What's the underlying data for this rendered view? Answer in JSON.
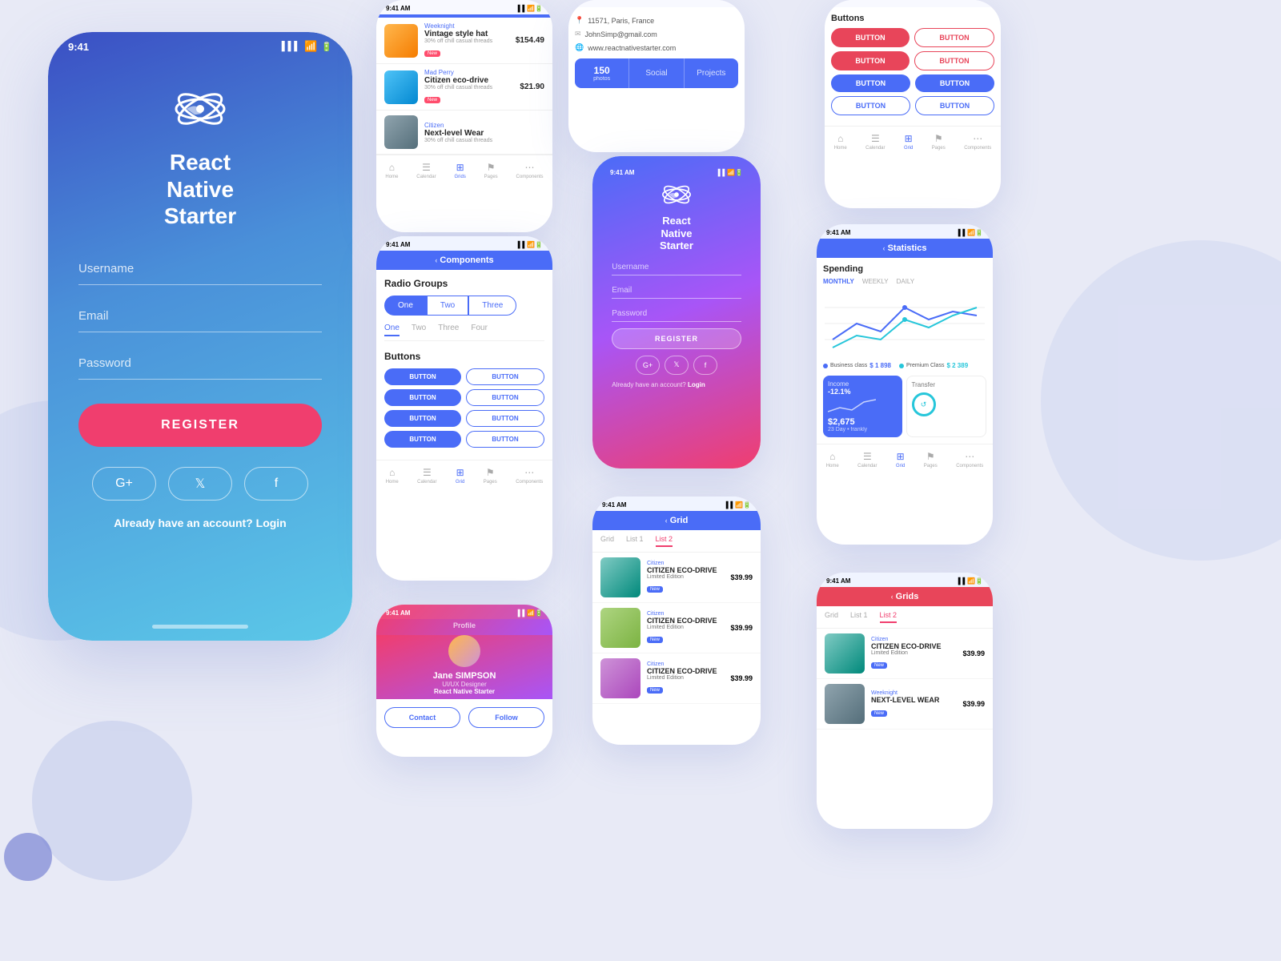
{
  "background": {
    "color": "#e8eaf6"
  },
  "main_phone": {
    "time": "9:41",
    "logo_text": "React\nNative\nStarter",
    "fields": {
      "username": "Username",
      "email": "Email",
      "password": "Password"
    },
    "register_btn": "REGISTER",
    "social": [
      "G+",
      "🐦",
      "f"
    ],
    "already_text": "Already have an account?",
    "login_text": "Login"
  },
  "phone2": {
    "header": "",
    "items": [
      {
        "brand": "Weeknight",
        "name": "Vintage style hat",
        "sub": "30% off chill casual threads",
        "badge": "New",
        "price": "$154.49",
        "img": "hat"
      },
      {
        "brand": "Mad Perry",
        "name": "Citizen eco-drive",
        "sub": "30% off chill casual threads",
        "badge": "New",
        "price": "$21.90",
        "img": "ocean"
      },
      {
        "brand": "Citizen",
        "name": "Next-level Wear",
        "sub": "30% off chill casual threads",
        "badge": "",
        "price": "",
        "img": "city"
      }
    ]
  },
  "phone3": {
    "address": "11571, Paris, France",
    "email": "JohnSimp@gmail.com",
    "website": "www.reactnativestarter.com",
    "stats": [
      {
        "num": "150",
        "label": "photos"
      },
      {
        "label": "Social"
      },
      {
        "label": "Projects"
      }
    ]
  },
  "phone4": {
    "title": "Buttons",
    "rows": [
      [
        "BUTTON",
        "BUTTON"
      ],
      [
        "BUTTON",
        "BUTTON"
      ],
      [
        "BUTTON",
        "BUTTON"
      ],
      [
        "BUTTON",
        "BUTTON"
      ]
    ]
  },
  "phone5": {
    "header": "Components",
    "radio_groups_label": "Radio Groups",
    "radio1": [
      "One",
      "Two",
      "Three"
    ],
    "radio2": [
      "One",
      "Two",
      "Three",
      "Four"
    ],
    "buttons_label": "Buttons",
    "button_rows": [
      [
        "BUTTON",
        "BUTTON"
      ],
      [
        "BUTTON",
        "BUTTON"
      ],
      [
        "BUTTON",
        "BUTTON"
      ],
      [
        "BUTTON",
        "BUTTON"
      ]
    ]
  },
  "phone6": {
    "logo_text": "React\nNative\nStarter",
    "username": "Username",
    "email": "Email",
    "password": "Password",
    "register_btn": "REGISTER",
    "social": [
      "G+",
      "🐦",
      "f"
    ],
    "already_text": "Already have an account?",
    "login_text": "Login"
  },
  "phone7": {
    "header": "Statistics",
    "spending": "Spending",
    "tabs": [
      "MONTHLY",
      "WEEKLY",
      "DAILY"
    ],
    "legend": [
      {
        "label": "Business class",
        "value": "$ 1 898",
        "color": "#4a6cf7"
      },
      {
        "label": "Premium Class",
        "value": "$ 2 389",
        "color": "#26c6da"
      }
    ],
    "income": {
      "title": "Income",
      "pct": "-12.1%",
      "amount": "$2,675",
      "sub": "23 Day"
    },
    "transfer": {
      "title": "Transfer",
      "sub": "frankly"
    }
  },
  "phone8": {
    "header": "Grid",
    "tabs": [
      "Grid",
      "List 1",
      "List 2"
    ],
    "active_tab": "List 2",
    "items": [
      {
        "brand": "Citizen",
        "name": "CITIZEN ECO-DRIVE",
        "sub": "Limited Edition",
        "badge": "New",
        "price": "$39.99",
        "img": "watch"
      },
      {
        "brand": "Citizen",
        "name": "CITIZEN ECO-DRIVE",
        "sub": "Limited Edition",
        "badge": "New",
        "price": "$39.99",
        "img": "business"
      },
      {
        "brand": "Citizen",
        "name": "CITIZEN ECO-DRIVE",
        "sub": "Limited Edition",
        "badge": "New",
        "price": "$39.99",
        "img": "person"
      }
    ]
  },
  "phone9": {
    "name": "Jane SIMPSON",
    "role": "UI/UX Designer",
    "employer": "React Native Starter",
    "actions": [
      "Contact",
      "Follow"
    ]
  },
  "phone10": {
    "header": "Grids",
    "tabs": [
      "Grid",
      "List 1",
      "List 2"
    ],
    "active_tab": "List 2",
    "items": [
      {
        "brand": "Citizen",
        "name": "CITIZEN ECO-DRIVE",
        "sub": "Limited Edition",
        "badge": "New",
        "price": "$39.99",
        "img": "watch"
      },
      {
        "brand": "Weeknight",
        "name": "NEXT-LEVEL WEAR",
        "sub": "",
        "badge": "New",
        "price": "$39.99",
        "img": "city"
      }
    ]
  },
  "nav_items": [
    "Home",
    "Calendar",
    "Grid",
    "Pages",
    "Components"
  ]
}
